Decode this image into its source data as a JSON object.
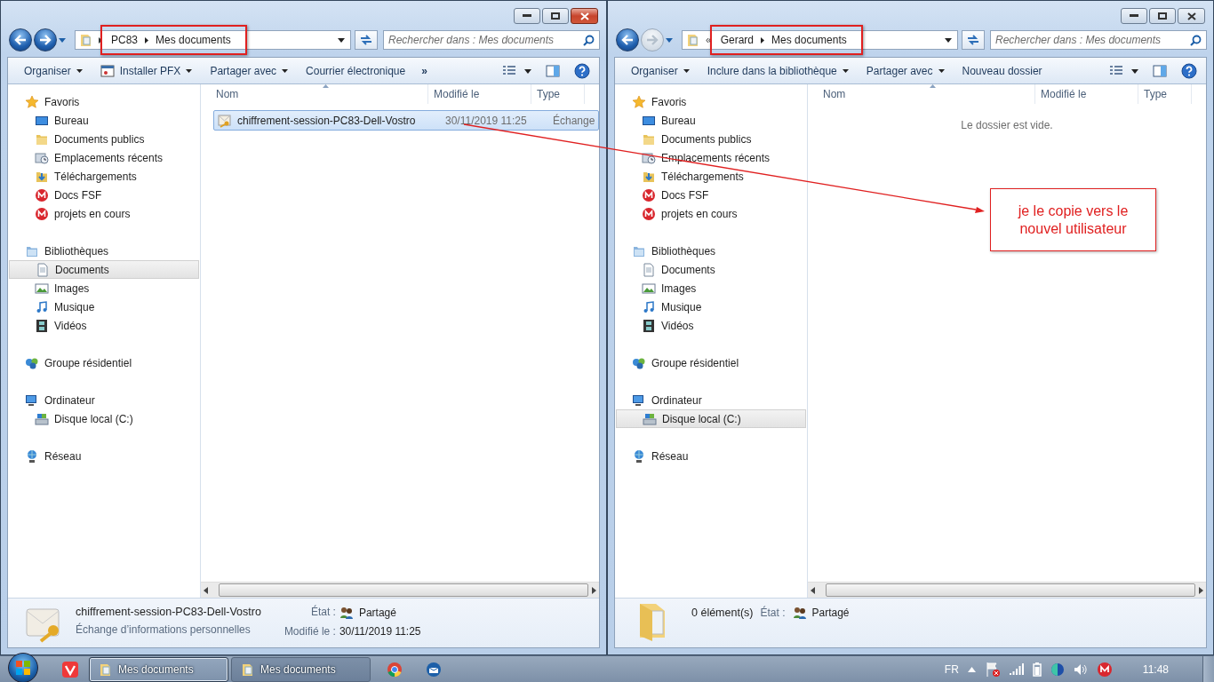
{
  "windows": [
    {
      "active": true,
      "forward_enabled": true,
      "breadcrumb": [
        "PC83",
        "Mes documents"
      ],
      "breadcrumb_highlighted": true,
      "search_placeholder": "Rechercher dans : Mes documents",
      "toolbar": [
        {
          "label": "Organiser",
          "kind": "menu"
        },
        {
          "label": "Installer PFX",
          "kind": "icon-menu"
        },
        {
          "label": "Partager avec",
          "kind": "menu"
        },
        {
          "label": "Courrier électronique",
          "kind": "button"
        },
        {
          "label": "»",
          "kind": "more"
        }
      ],
      "columns": [
        "Nom",
        "Modifié le",
        "Type"
      ],
      "sidebar": [
        {
          "label": "Favoris",
          "kind": "star",
          "selected": false,
          "children": [
            {
              "label": "Bureau",
              "kind": "desktop",
              "selected": false
            },
            {
              "label": "Documents publics",
              "kind": "folder",
              "selected": false
            },
            {
              "label": "Emplacements récents",
              "kind": "recent",
              "selected": false
            },
            {
              "label": "Téléchargements",
              "kind": "download",
              "selected": false
            },
            {
              "label": "Docs FSF",
              "kind": "mega",
              "selected": false
            },
            {
              "label": "projets en cours",
              "kind": "mega",
              "selected": false
            }
          ]
        },
        {
          "label": "Bibliothèques",
          "kind": "library",
          "selected": false,
          "children": [
            {
              "label": "Documents",
              "kind": "document",
              "selected": true
            },
            {
              "label": "Images",
              "kind": "images",
              "selected": false
            },
            {
              "label": "Musique",
              "kind": "music",
              "selected": false
            },
            {
              "label": "Vidéos",
              "kind": "video",
              "selected": false
            }
          ]
        },
        {
          "label": "Groupe résidentiel",
          "kind": "homegroup",
          "selected": false
        },
        {
          "label": "Ordinateur",
          "kind": "computer",
          "selected": false,
          "children": [
            {
              "label": "Disque local (C:)",
              "kind": "drive",
              "selected": false
            }
          ]
        },
        {
          "label": "Réseau",
          "kind": "network",
          "selected": false
        }
      ],
      "files": [
        {
          "name": "chiffrement-session-PC83-Dell-Vostro",
          "modified": "30/11/2019 11:25",
          "type": "Échange",
          "selected": true
        }
      ],
      "details": {
        "kind": "file",
        "title": "chiffrement-session-PC83-Dell-Vostro",
        "subtitle": "Échange d’informations personnelles",
        "fields": [
          {
            "label": "État :",
            "value": "Partagé",
            "kind": "shared"
          },
          {
            "label": "Modifié le :",
            "value": "30/11/2019 11:25",
            "kind": "text"
          }
        ]
      }
    },
    {
      "active": false,
      "forward_enabled": false,
      "breadcrumb_prefix": "«",
      "breadcrumb": [
        "Gerard",
        "Mes documents"
      ],
      "breadcrumb_highlighted": true,
      "search_placeholder": "Rechercher dans : Mes documents",
      "toolbar": [
        {
          "label": "Organiser",
          "kind": "menu"
        },
        {
          "label": "Inclure dans la bibliothèque",
          "kind": "menu"
        },
        {
          "label": "Partager avec",
          "kind": "menu"
        },
        {
          "label": "Nouveau dossier",
          "kind": "button"
        }
      ],
      "columns": [
        "Nom",
        "Modifié le",
        "Type"
      ],
      "sidebar": [
        {
          "label": "Favoris",
          "kind": "star",
          "selected": false,
          "children": [
            {
              "label": "Bureau",
              "kind": "desktop",
              "selected": false
            },
            {
              "label": "Documents publics",
              "kind": "folder",
              "selected": false
            },
            {
              "label": "Emplacements récents",
              "kind": "recent",
              "selected": false
            },
            {
              "label": "Téléchargements",
              "kind": "download",
              "selected": false
            },
            {
              "label": "Docs FSF",
              "kind": "mega",
              "selected": false
            },
            {
              "label": "projets en cours",
              "kind": "mega",
              "selected": false
            }
          ]
        },
        {
          "label": "Bibliothèques",
          "kind": "library",
          "selected": false,
          "children": [
            {
              "label": "Documents",
              "kind": "document",
              "selected": false
            },
            {
              "label": "Images",
              "kind": "images",
              "selected": false
            },
            {
              "label": "Musique",
              "kind": "music",
              "selected": false
            },
            {
              "label": "Vidéos",
              "kind": "video",
              "selected": false
            }
          ]
        },
        {
          "label": "Groupe résidentiel",
          "kind": "homegroup",
          "selected": false
        },
        {
          "label": "Ordinateur",
          "kind": "computer",
          "selected": false,
          "children": [
            {
              "label": "Disque local (C:)",
              "kind": "drive",
              "selected": true
            }
          ]
        },
        {
          "label": "Réseau",
          "kind": "network",
          "selected": false
        }
      ],
      "empty_message": "Le dossier est vide.",
      "details": {
        "kind": "folder",
        "title": "0 élément(s)",
        "fields": [
          {
            "label": "État :",
            "value": "Partagé",
            "kind": "shared"
          }
        ]
      }
    }
  ],
  "annotation": {
    "text": "je le copie vers le nouvel utilisateur"
  },
  "taskbar": {
    "tasks": [
      {
        "label": "Mes documents",
        "selected": true
      },
      {
        "label": "Mes documents",
        "selected": false
      }
    ],
    "language": "FR",
    "clock": "11:48"
  }
}
